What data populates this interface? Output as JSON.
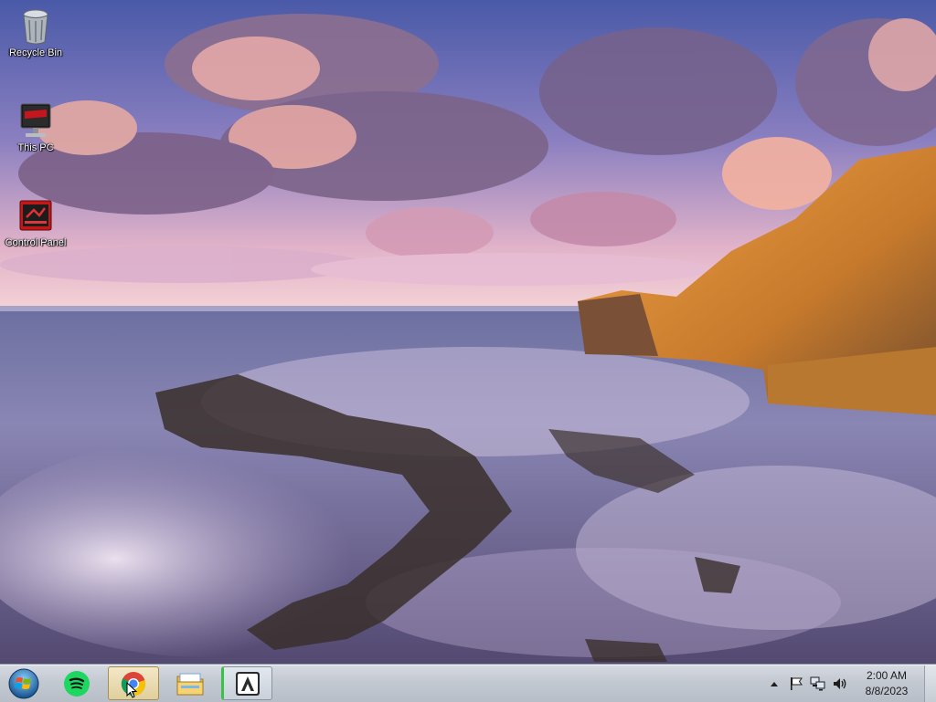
{
  "desktop": {
    "icons": [
      {
        "label": "Recycle Bin",
        "icon": "recycle-bin-icon"
      },
      {
        "label": "This PC",
        "icon": "this-pc-icon"
      },
      {
        "label": "Control Panel",
        "icon": "control-panel-icon"
      }
    ]
  },
  "taskbar": {
    "start_icon": "windows-start-orb-icon",
    "pinned": [
      {
        "icon": "spotify-icon",
        "state": "pinned"
      },
      {
        "icon": "chrome-icon",
        "state": "active"
      },
      {
        "icon": "file-explorer-icon",
        "state": "pinned"
      },
      {
        "icon": "adobe-reader-icon",
        "state": "open"
      }
    ],
    "tray": {
      "icons": [
        "show-hidden-icons-icon",
        "action-center-flag-icon",
        "network-icon",
        "volume-icon"
      ],
      "time": "2:00 AM",
      "date": "8/8/2023"
    }
  },
  "colors": {
    "taskbar": "#c3c9d1",
    "active_button": "#e0cf9c",
    "spotify": "#1ed760",
    "adobe": "#39c24a"
  }
}
